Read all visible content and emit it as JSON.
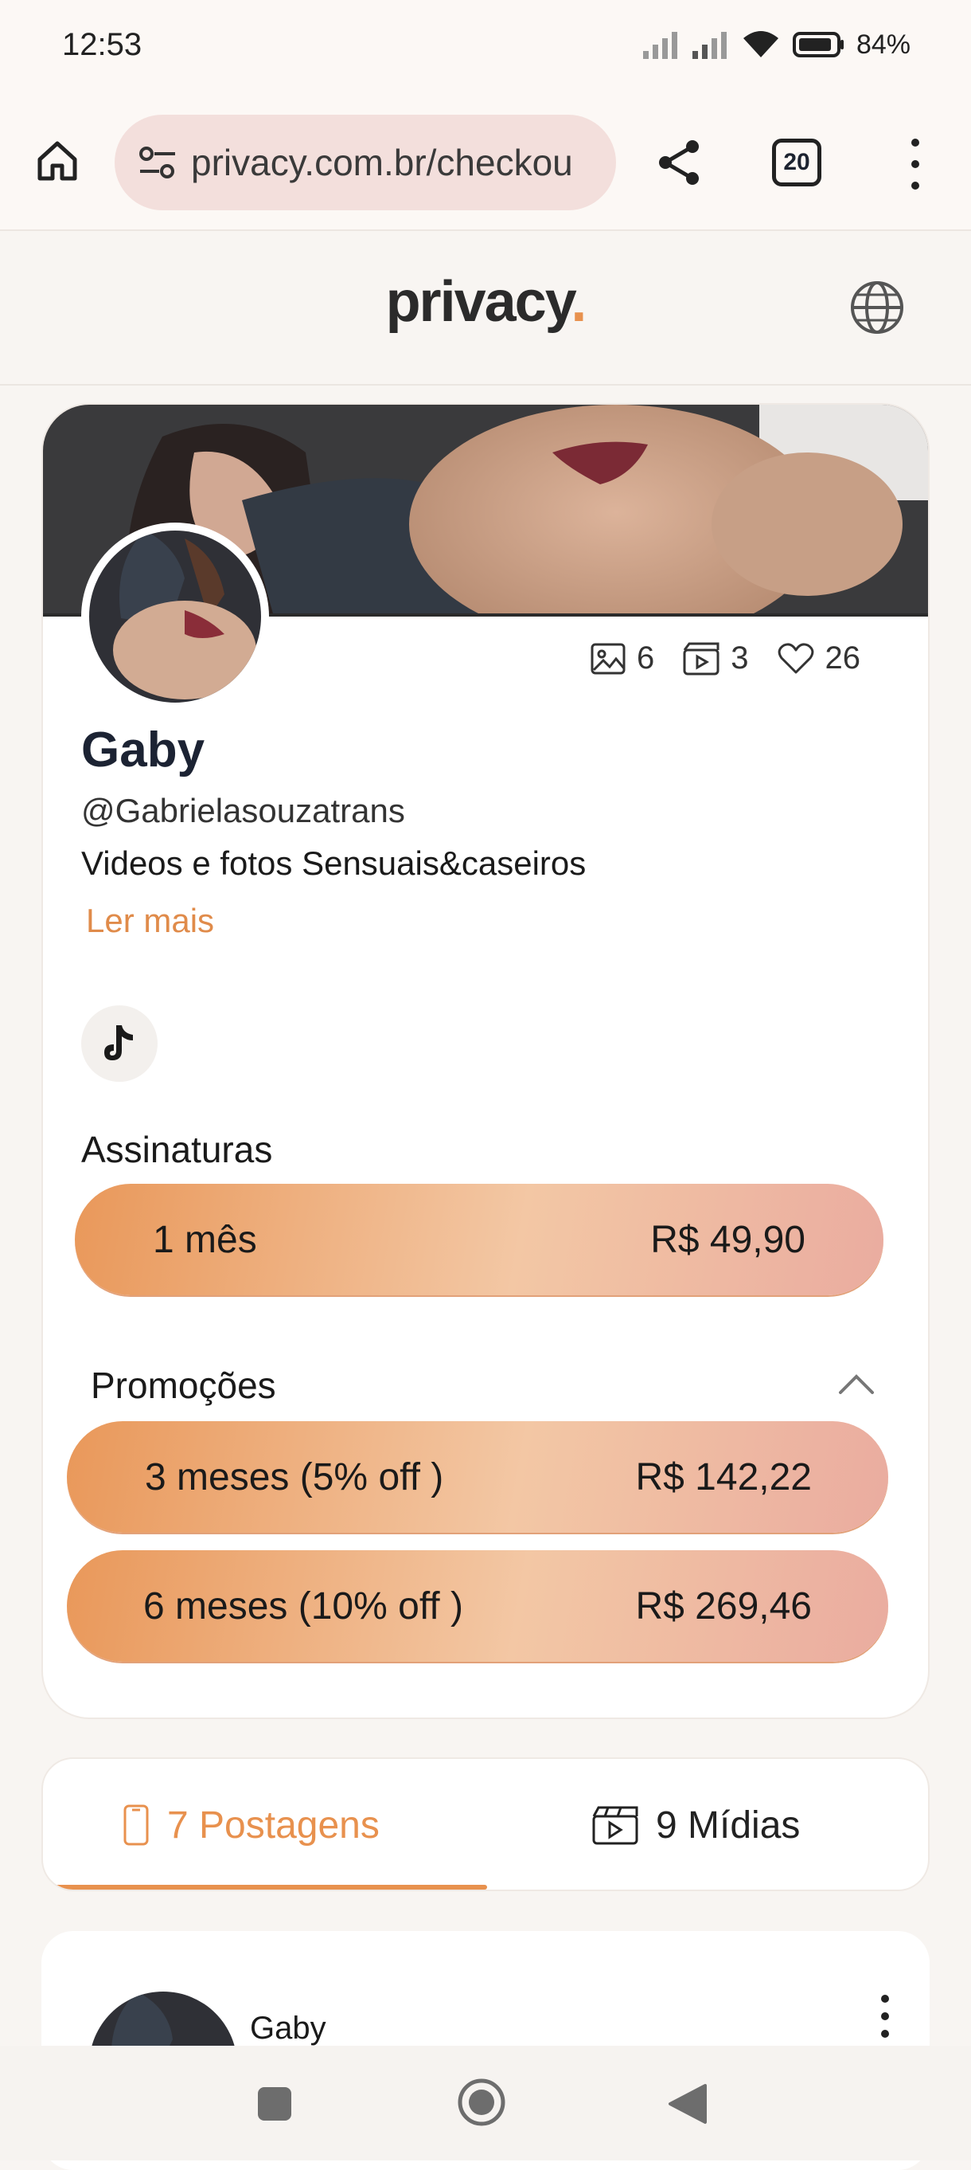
{
  "status_bar": {
    "time": "12:53",
    "battery": "84%"
  },
  "browser": {
    "url": "privacy.com.br/checkou",
    "tab_count": "20"
  },
  "site": {
    "logo_text": "privacy",
    "logo_dot": "."
  },
  "profile": {
    "stats": {
      "photos": "6",
      "videos": "3",
      "likes": "26"
    },
    "name": "Gaby",
    "handle": "@Gabrielasouzatrans",
    "bio": "Videos e fotos Sensuais&caseiros",
    "read_more": "Ler mais"
  },
  "subscriptions": {
    "title": "Assinaturas",
    "plans": [
      {
        "label": "1 mês",
        "price": "R$ 49,90"
      }
    ]
  },
  "promotions": {
    "title": "Promoções",
    "plans": [
      {
        "label": "3 meses (5% off )",
        "price": "R$ 142,22"
      },
      {
        "label": "6 meses (10% off )",
        "price": "R$ 269,46"
      }
    ]
  },
  "tabs": [
    {
      "label": "7 Postagens",
      "active": true
    },
    {
      "label": "9 Mídias",
      "active": false
    }
  ],
  "post": {
    "author": "Gaby"
  },
  "colors": {
    "accent": "#e8914e",
    "button_gradient_start": "#e9985a",
    "button_gradient_end": "#eaaca0"
  },
  "icons": [
    "home-icon",
    "site-info-icon",
    "share-icon",
    "tabs-icon",
    "more-vert-icon",
    "globe-icon",
    "image-icon",
    "video-icon",
    "heart-icon",
    "tiktok-icon",
    "chevron-up-icon",
    "phone-icon",
    "clapperboard-icon"
  ]
}
